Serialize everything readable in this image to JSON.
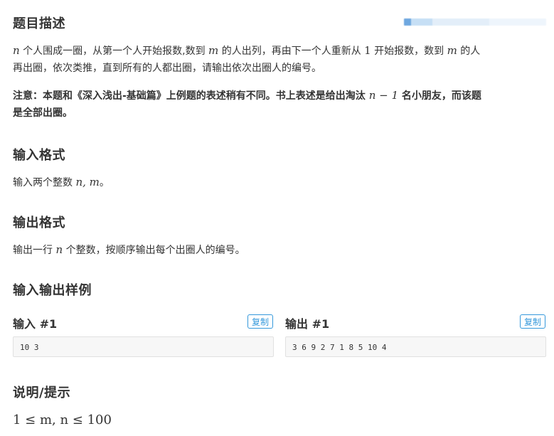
{
  "description": {
    "heading": "题目描述",
    "line1_var_n": "n",
    "line1_text_a": " 个人围成一圈，从第一个人开始报数,数到 ",
    "line1_var_m": "m",
    "line1_text_b": " 的人出列，再由下一个人重新从 ",
    "line1_num": "1",
    "line1_text_c": " 开始报数，数到 ",
    "line1_var_m2": "m",
    "line1_text_d": " 的人",
    "line2": "再出圈，依次类推，直到所有的人都出圈，请输出依次出圈人的编号。",
    "note_a": "注意：本题和《深入浅出-基础篇》上例题的表述稍有不同。书上表述是给出淘汰 ",
    "note_math": "n − 1",
    "note_b": " 名小朋友，而该题",
    "note_line2": "是全部出圈。"
  },
  "input_format": {
    "heading": "输入格式",
    "text_a": "输入两个整数 ",
    "math": "n, m",
    "text_b": "。"
  },
  "output_format": {
    "heading": "输出格式",
    "text_a": "输出一行 ",
    "math": "n",
    "text_b": " 个整数，按顺序输出每个出圈人的编号。"
  },
  "samples": {
    "heading": "输入输出样例",
    "input_label": "输入 #1",
    "output_label": "输出 #1",
    "copy_label": "复制",
    "input_value": "10 3",
    "output_value": "3 6 9 2 7 1 8 5 10 4"
  },
  "hint": {
    "heading": "说明/提示",
    "math": "1 ≤ m, n ≤ 100"
  }
}
